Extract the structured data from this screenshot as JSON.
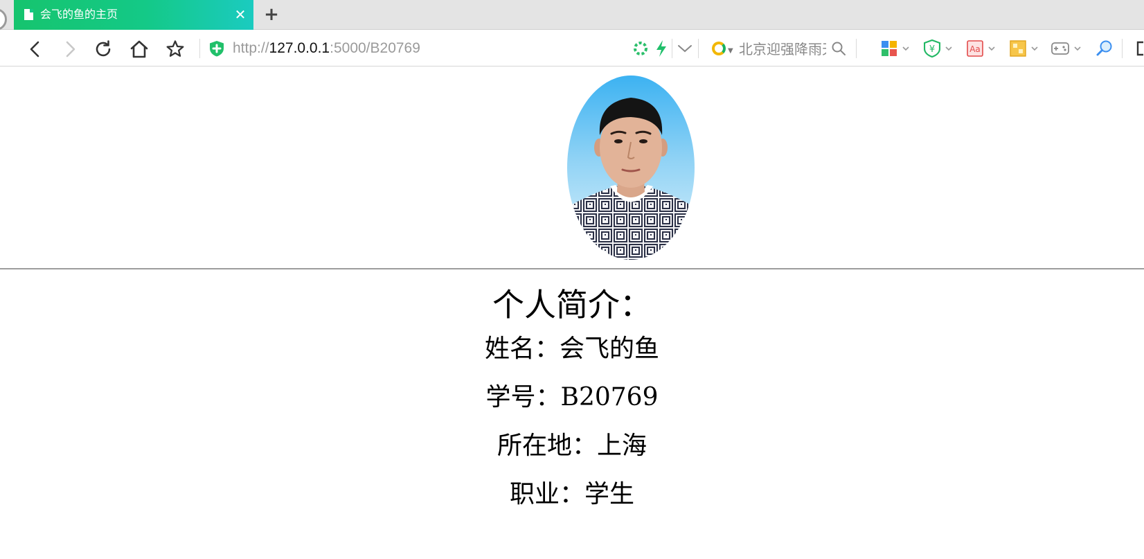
{
  "browser": {
    "tab": {
      "title": "会飞的鱼的主页",
      "close_glyph": "✕"
    },
    "new_tab_glyph": "+",
    "address": {
      "scheme": "http://",
      "host": "127.0.0.1",
      "rest": ":5000/B20769"
    },
    "search": {
      "text": "北京迎强降雨天"
    }
  },
  "profile": {
    "heading": "个人简介：",
    "name": "姓名：会飞的鱼",
    "student_id": "学号：B20769",
    "location": "所在地：上海",
    "occupation": "职业：学生"
  },
  "colors": {
    "tab_gradient_start": "#16c46e",
    "tab_gradient_end": "#1bcbc0",
    "shield": "#21c06a",
    "divider": "#9c9c9c"
  },
  "icons": [
    "page-icon",
    "close-icon",
    "plus-icon",
    "back-icon",
    "forward-icon",
    "reload-icon",
    "home-icon",
    "bookmark-star-icon",
    "security-shield-icon",
    "loading-spinner-icon",
    "lightning-icon",
    "chevron-down-icon",
    "search-icon",
    "apps-icon",
    "money-shield-icon",
    "translate-icon",
    "gift-icon",
    "game-icon",
    "zoom-icon"
  ]
}
